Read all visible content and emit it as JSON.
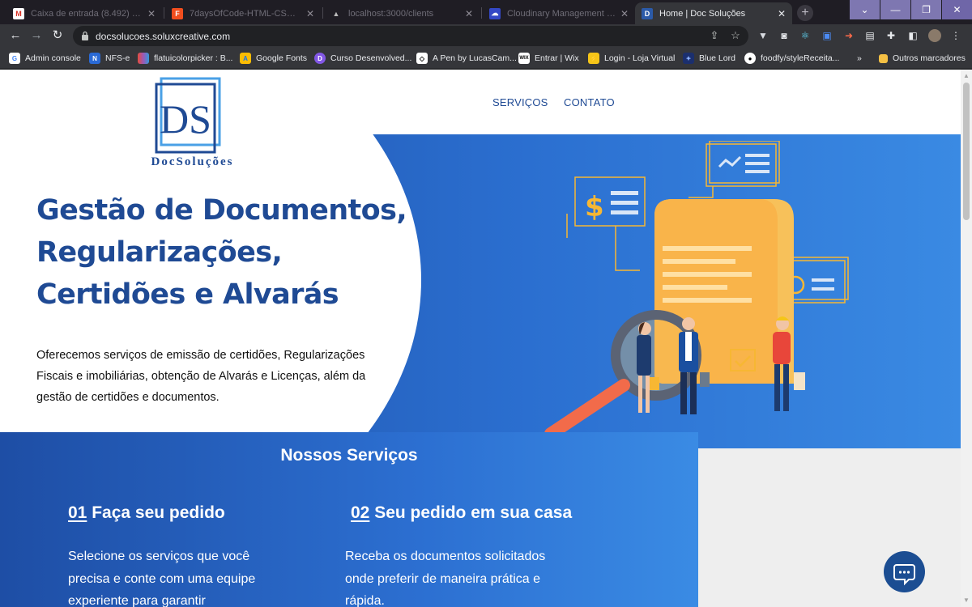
{
  "browser": {
    "tabs": [
      {
        "title": "Caixa de entrada (8.492) - solu",
        "icon": "gmail-icon",
        "active": false
      },
      {
        "title": "7daysOfCode-HTML-CSS – Fig",
        "icon": "figma-icon",
        "active": false
      },
      {
        "title": "localhost:3000/clients",
        "icon": "vercel-icon",
        "active": false
      },
      {
        "title": "Cloudinary Management Com",
        "icon": "cloudinary-icon",
        "active": false
      },
      {
        "title": "Home | Doc Soluções",
        "icon": "docsolucoes-icon",
        "active": true
      }
    ],
    "new_tab": "+",
    "url": "docsolucoes.soluxcreative.com",
    "bookmarks": [
      {
        "label": "Admin console",
        "icon": "google-icon"
      },
      {
        "label": "NFS-e",
        "icon": "nfse-icon"
      },
      {
        "label": "flatuicolorpicker : B...",
        "icon": "flatui-icon"
      },
      {
        "label": "Google Fonts",
        "icon": "google-fonts-icon"
      },
      {
        "label": "Curso Desenvolved...",
        "icon": "course-icon"
      },
      {
        "label": "A Pen by LucasCam...",
        "icon": "codepen-icon"
      },
      {
        "label": "Entrar | Wix",
        "icon": "wix-icon"
      },
      {
        "label": "Login - Loja Virtual",
        "icon": "store-icon"
      },
      {
        "label": "Blue Lord",
        "icon": "bluelord-icon"
      },
      {
        "label": "foodfy/styleReceita...",
        "icon": "github-icon"
      }
    ],
    "bookmarks_overflow": "»",
    "other_bookmarks": "Outros marcadores"
  },
  "site": {
    "logo_monogram": "DS",
    "logo_text": "DocSoluções",
    "nav": {
      "services": "SERVIÇOS",
      "contact": "CONTATO"
    },
    "hero": {
      "title_lines": [
        "Gestão de Documentos,",
        "Regularizações,",
        "Certidões e Alvarás"
      ],
      "text": "Oferecemos serviços de emissão de certidões, Regularizações Fiscais e imobiliárias, obtenção de Alvarás e Licenças, além da gestão de certidões e documentos."
    },
    "services": {
      "heading": "Nossos Serviços",
      "items": [
        {
          "num": "01",
          "title": "Faça seu pedido",
          "text": "Selecione os serviços que você precisa e conte com uma equipe experiente para garantir"
        },
        {
          "num": "02",
          "title": "Seu pedido em sua casa",
          "text": "Receba os documentos solicitados onde preferir de maneira prática e rápida."
        }
      ]
    }
  },
  "colors": {
    "brand_blue": "#1f4a94",
    "hero_gradient_start": "#1e4ea5",
    "hero_gradient_end": "#3a8ae3",
    "accent_yellow": "#f7b733"
  }
}
